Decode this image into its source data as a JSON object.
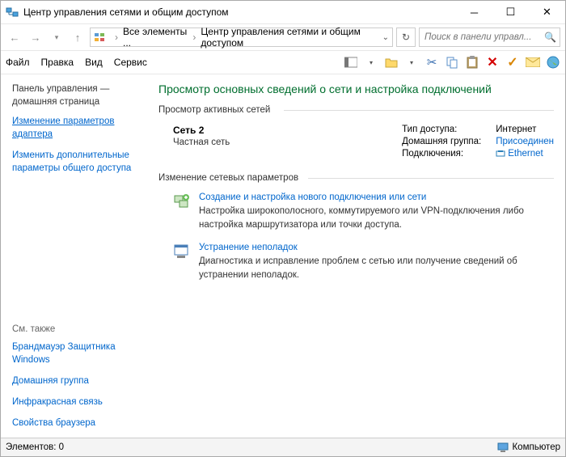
{
  "window": {
    "title": "Центр управления сетями и общим доступом"
  },
  "breadcrumb": {
    "root": "Все элементы ...",
    "current": "Центр управления сетями и общим доступом"
  },
  "search": {
    "placeholder": "Поиск в панели управл..."
  },
  "menu": {
    "file": "Файл",
    "edit": "Правка",
    "view": "Вид",
    "service": "Сервис"
  },
  "sidebar": {
    "home1": "Панель управления —",
    "home2": "домашняя страница",
    "link_adapter": "Изменение параметров адаптера",
    "link_sharing": "Изменить дополнительные параметры общего доступа",
    "see_also": "См. также",
    "firewall": "Брандмауэр Защитника Windows",
    "homegroup": "Домашняя группа",
    "infrared": "Инфракрасная связь",
    "browser": "Свойства браузера"
  },
  "main": {
    "title": "Просмотр основных сведений о сети и настройка подключений",
    "group_active": "Просмотр активных сетей",
    "net_name": "Сеть 2",
    "net_type": "Частная сеть",
    "label_access": "Тип доступа:",
    "val_access": "Интернет",
    "label_homegroup": "Домашняя группа:",
    "val_homegroup": "Присоединен",
    "label_conn": "Подключения:",
    "val_conn": "Ethernet",
    "group_settings": "Изменение сетевых параметров",
    "task1_title": "Создание и настройка нового подключения или сети",
    "task1_desc": "Настройка широкополосного, коммутируемого или VPN-подключения либо настройка маршрутизатора или точки доступа.",
    "task2_title": "Устранение неполадок",
    "task2_desc": "Диагностика и исправление проблем с сетью или получение сведений об устранении неполадок."
  },
  "status": {
    "elements": "Элементов: 0",
    "right": "Компьютер"
  }
}
